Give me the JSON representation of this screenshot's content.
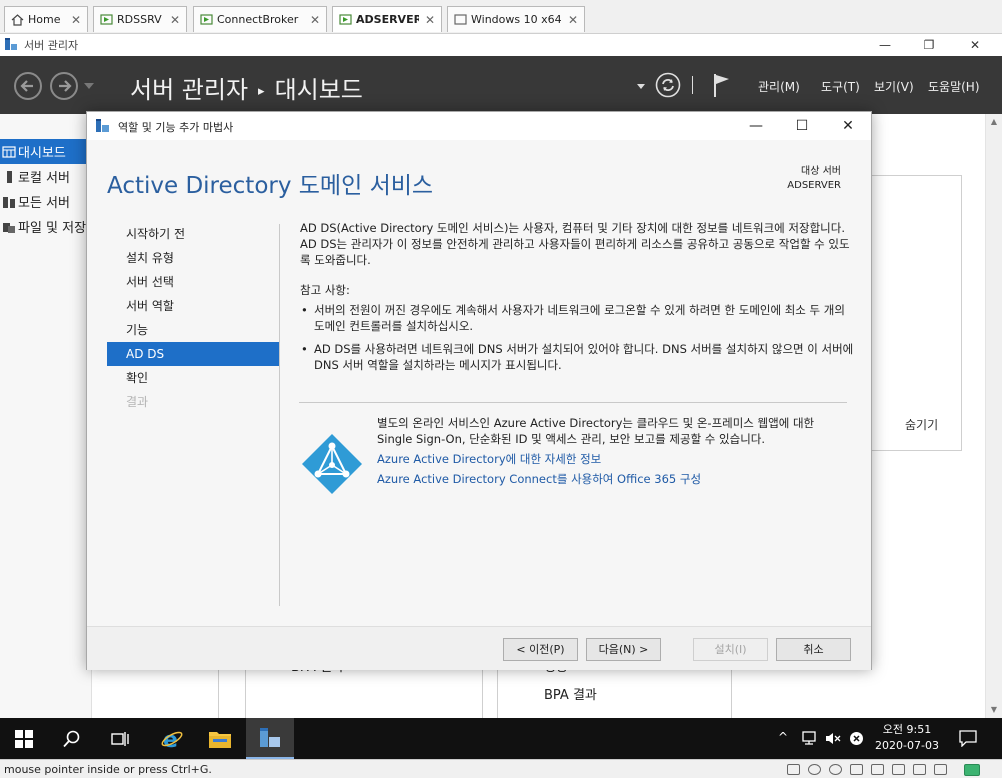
{
  "vm_tabs": [
    {
      "label": "Home",
      "icon": "home-icon"
    },
    {
      "label": "RDSSRV",
      "icon": "vm-icon"
    },
    {
      "label": "ConnectBroker",
      "icon": "vm-icon"
    },
    {
      "label": "ADSERVER",
      "icon": "vm-icon",
      "active": true
    },
    {
      "label": "Windows 10 x64",
      "icon": "vm-icon"
    }
  ],
  "server_manager": {
    "window_title": "서버 관리자",
    "breadcrumb": {
      "app": "서버 관리자",
      "page": "대시보드"
    },
    "menu": [
      "관리(M)",
      "도구(T)",
      "보기(V)",
      "도움말(H)"
    ],
    "sidebar": [
      {
        "label": "대시보드",
        "icon": "dashboard-icon",
        "selected": true
      },
      {
        "label": "로컬 서버",
        "icon": "server-icon"
      },
      {
        "label": "모든 서버",
        "icon": "servers-icon"
      },
      {
        "label": "파일 및 저장소 서비스",
        "icon": "folder-icon"
      }
    ],
    "hide_label": "숨기기",
    "tiles": {
      "bpa_left": "BPA 결과",
      "perf_right": "성능",
      "bpa_right": "BPA 결과"
    }
  },
  "wizard": {
    "title": "역할 및 기능 추가 마법사",
    "heading": "Active Directory 도메인 서비스",
    "target_label": "대상 서버",
    "target_server": "ADSERVER",
    "steps": [
      {
        "label": "시작하기 전",
        "state": "normal"
      },
      {
        "label": "설치 유형",
        "state": "normal"
      },
      {
        "label": "서버 선택",
        "state": "normal"
      },
      {
        "label": "서버 역할",
        "state": "normal"
      },
      {
        "label": "기능",
        "state": "normal"
      },
      {
        "label": "AD DS",
        "state": "selected"
      },
      {
        "label": "확인",
        "state": "normal"
      },
      {
        "label": "결과",
        "state": "disabled"
      }
    ],
    "intro": "AD DS(Active Directory 도메인 서비스)는 사용자, 컴퓨터 및 기타 장치에 대한 정보를 네트워크에 저장합니다. AD DS는 관리자가 이 정보를 안전하게 관리하고 사용자들이 편리하게 리소스를 공유하고 공동으로 작업할 수 있도록 도와줍니다.",
    "notes_title": "참고 사항:",
    "notes": [
      "서버의 전원이 꺼진 경우에도 계속해서 사용자가 네트워크에 로그온할 수 있게 하려면 한 도메인에 최소 두 개의 도메인 컨트롤러를 설치하십시오.",
      "AD DS를 사용하려면 네트워크에 DNS 서버가 설치되어 있어야 합니다. DNS 서버를 설치하지 않으면 이 서버에 DNS 서버 역할을 설치하라는 메시지가 표시됩니다."
    ],
    "azure_text": "별도의 온라인 서비스인 Azure Active Directory는 클라우드 및 온-프레미스 웹앱에 대한 Single Sign-On, 단순화된 ID 및 액세스 관리, 보안 보고를 제공할 수 있습니다.",
    "azure_links": [
      "Azure Active Directory에 대한 자세한 정보",
      "Azure Active Directory Connect를 사용하여 Office 365 구성"
    ],
    "buttons": {
      "prev": "< 이전(P)",
      "next": "다음(N) >",
      "install": "설치(I)",
      "cancel": "취소"
    },
    "colors": {
      "heading": "#2b5f9f",
      "selection": "#1e6fc8",
      "link": "#1f5aa6",
      "azure": "#2f9bd6"
    }
  },
  "taskbar": {
    "time": "오전 9:51",
    "date": "2020-07-03"
  },
  "status_bar": {
    "message": "mouse pointer inside or press Ctrl+G."
  }
}
